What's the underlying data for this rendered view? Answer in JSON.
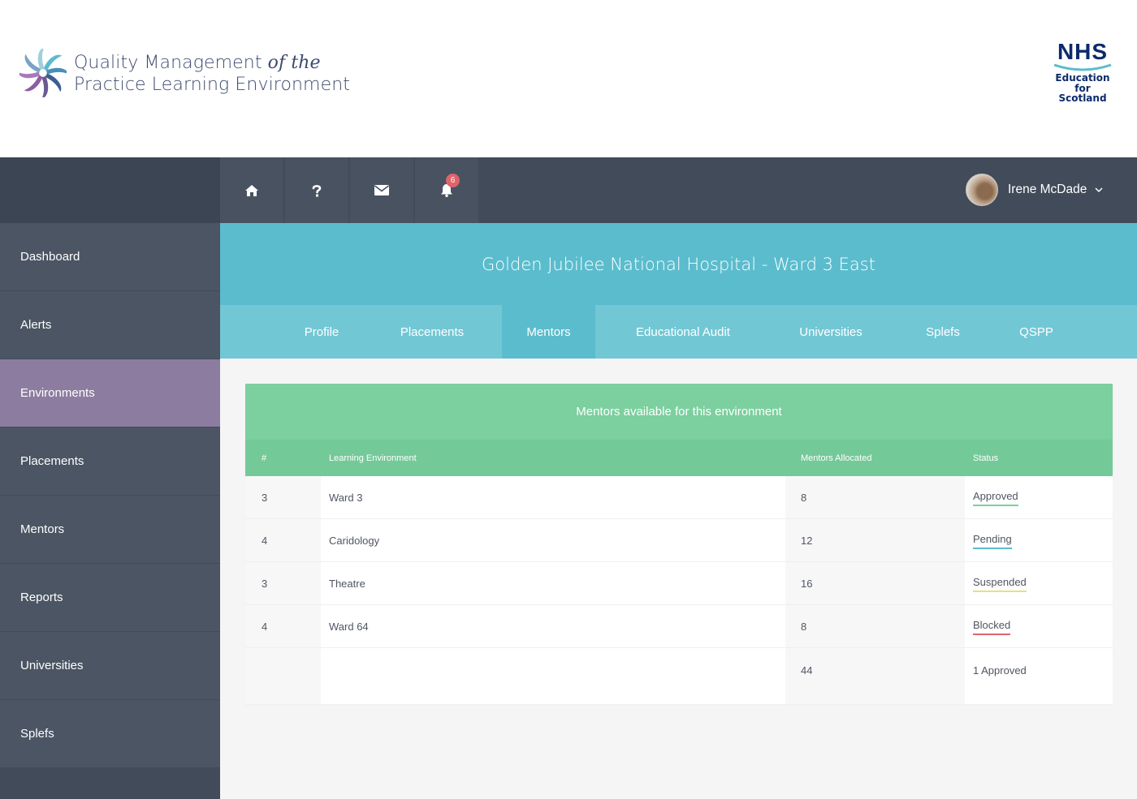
{
  "brand": {
    "logo_line1_prefix": "Quality Management ",
    "logo_line1_italic": "of the",
    "logo_line2": "Practice Learning Environment",
    "nhs_word": "NHS",
    "nhs_sub1": "Education",
    "nhs_sub2": "for",
    "nhs_sub3": "Scotland"
  },
  "topbar": {
    "home_icon": "home-icon",
    "help_icon": "question-icon",
    "mail_icon": "envelope-icon",
    "bell_icon": "bell-icon",
    "notification_count": "6",
    "user_name": "Irene McDade"
  },
  "sidebar": {
    "items": [
      {
        "label": "Dashboard"
      },
      {
        "label": "Alerts"
      },
      {
        "label": "Environments"
      },
      {
        "label": "Placements"
      },
      {
        "label": "Mentors"
      },
      {
        "label": "Reports"
      },
      {
        "label": "Universities"
      },
      {
        "label": "Splefs"
      }
    ],
    "active": "Environments"
  },
  "main": {
    "title": "Golden Jubilee National Hospital - Ward 3 East",
    "tabs": [
      {
        "label": "Profile"
      },
      {
        "label": "Placements"
      },
      {
        "label": "Mentors"
      },
      {
        "label": "Educational Audit"
      },
      {
        "label": "Universities"
      },
      {
        "label": "Splefs"
      },
      {
        "label": "QSPP"
      }
    ],
    "active_tab": "Mentors"
  },
  "table": {
    "title": "Mentors available for this environment",
    "headers": [
      "#",
      "Learning Environment",
      "Mentors Allocated",
      "Status"
    ],
    "rows": [
      {
        "num": "3",
        "env": "Ward 3",
        "mentors": "8",
        "status": "Approved",
        "status_color": "#7ccf9e"
      },
      {
        "num": "4",
        "env": "Caridology",
        "mentors": "12",
        "status": "Pending",
        "status_color": "#5bbccd"
      },
      {
        "num": "3",
        "env": "Theatre",
        "mentors": "16",
        "status": "Suspended",
        "status_color": "#e6e27a"
      },
      {
        "num": "4",
        "env": "Ward 64",
        "mentors": "8",
        "status": "Blocked",
        "status_color": "#e0636a"
      }
    ],
    "totals": {
      "mentors": "44",
      "status": "1 Approved"
    }
  },
  "colors": {
    "sidebar": "#4b5563",
    "sidebar_active": "#8c7da0",
    "banner": "#5bbccd",
    "tabs": "#72c7d5",
    "table_header": "#7ccf9e",
    "badge": "#e0636a"
  }
}
